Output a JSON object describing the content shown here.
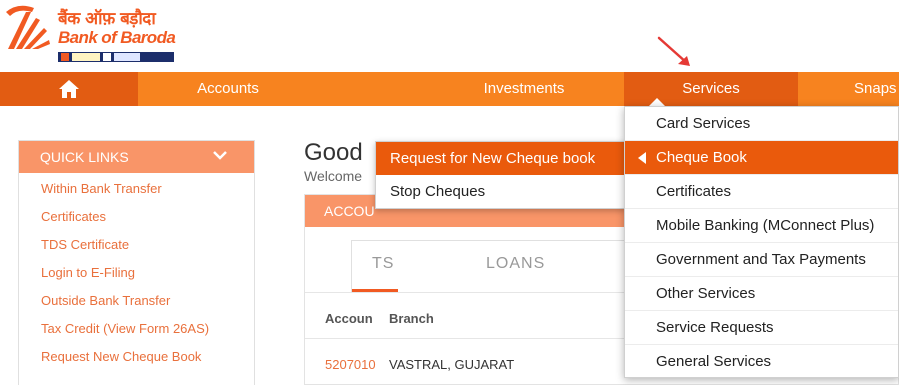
{
  "brand": {
    "name_hindi": "बैंक ऑफ़ बड़ौदा",
    "name_english": "Bank of Baroda",
    "colors": {
      "orange": "#f15a22",
      "nav": "#f7831f",
      "nav_dark": "#e25c12",
      "navy": "#1c2e6b"
    }
  },
  "nav": {
    "home_icon": "home-icon",
    "items": [
      {
        "label": "Accounts"
      },
      {
        "label": "Investments"
      },
      {
        "label": "Services"
      },
      {
        "label": "Snaps"
      }
    ]
  },
  "quick_links": {
    "title": "QUICK LINKS",
    "toggle_icon": "chevron-down-icon",
    "items": [
      {
        "label": "Within Bank Transfer"
      },
      {
        "label": "Certificates"
      },
      {
        "label": "TDS Certificate"
      },
      {
        "label": "Login to E-Filing"
      },
      {
        "label": "Outside Bank Transfer"
      },
      {
        "label": "Tax Credit (View Form 26AS)"
      },
      {
        "label": "Request New Cheque Book"
      }
    ]
  },
  "main": {
    "greeting": "Good",
    "welcome": "Welcome",
    "panel_title": "ACCOU",
    "tabs": [
      {
        "label": "TS"
      },
      {
        "label": "LOANS"
      }
    ],
    "columns": [
      {
        "label": "Accoun"
      },
      {
        "label": "Branch"
      }
    ],
    "rows": [
      {
        "account": "5207010",
        "branch": "VASTRAL, GUJARAT"
      }
    ]
  },
  "services_menu": {
    "items": [
      {
        "label": "Card Services"
      },
      {
        "label": "Cheque Book",
        "active": true
      },
      {
        "label": "Certificates"
      },
      {
        "label": "Mobile Banking (MConnect Plus)"
      },
      {
        "label": "Government and Tax Payments"
      },
      {
        "label": "Other Services"
      },
      {
        "label": "Service Requests"
      },
      {
        "label": "General Services"
      }
    ]
  },
  "cheque_submenu": {
    "items": [
      {
        "label": "Request for New Cheque book",
        "active": true
      },
      {
        "label": "Stop Cheques"
      }
    ]
  }
}
